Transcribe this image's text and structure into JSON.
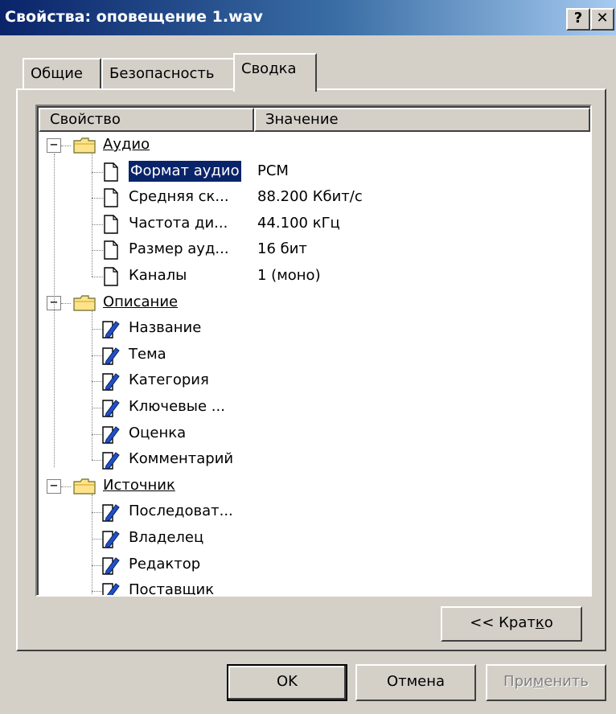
{
  "window": {
    "title": "Свойства: оповещение 1.wav",
    "help_button": "?",
    "close_button": "✕"
  },
  "tabs": [
    {
      "label": "Общие",
      "active": false
    },
    {
      "label": "Безопасность",
      "active": false
    },
    {
      "label": "Сводка",
      "active": true
    }
  ],
  "list": {
    "columns": {
      "property": "Свойство",
      "value": "Значение"
    },
    "groups": [
      {
        "label": "Аудио",
        "items": [
          {
            "label": "Формат аудио",
            "value": "PCM",
            "selected": true
          },
          {
            "label": "Средняя ск...",
            "value": "88.200 Кбит/с"
          },
          {
            "label": "Частота ди...",
            "value": "44.100 кГц"
          },
          {
            "label": "Размер ауд...",
            "value": "16 бит"
          },
          {
            "label": "Каналы",
            "value": "1 (моно)"
          }
        ]
      },
      {
        "label": "Описание",
        "items": [
          {
            "label": "Название",
            "value": ""
          },
          {
            "label": "Тема",
            "value": ""
          },
          {
            "label": "Категория",
            "value": ""
          },
          {
            "label": "Ключевые ...",
            "value": ""
          },
          {
            "label": "Оценка",
            "value": ""
          },
          {
            "label": "Комментарий",
            "value": ""
          }
        ]
      },
      {
        "label": "Источник",
        "items": [
          {
            "label": "Последоват...",
            "value": ""
          },
          {
            "label": "Владелец",
            "value": ""
          },
          {
            "label": "Редактор",
            "value": ""
          },
          {
            "label": "Поставщик",
            "value": ""
          }
        ]
      }
    ]
  },
  "buttons": {
    "brief_pre": "<< Крат",
    "brief_accel": "к",
    "brief_post": "о",
    "ok": "OK",
    "cancel": "Отмена",
    "apply_pre": "При",
    "apply_accel": "м",
    "apply_post": "енить"
  },
  "colors": {
    "face": "#d4d0c8",
    "title_start": "#0a246a",
    "title_end": "#a6caf0",
    "selection": "#0a246a"
  }
}
